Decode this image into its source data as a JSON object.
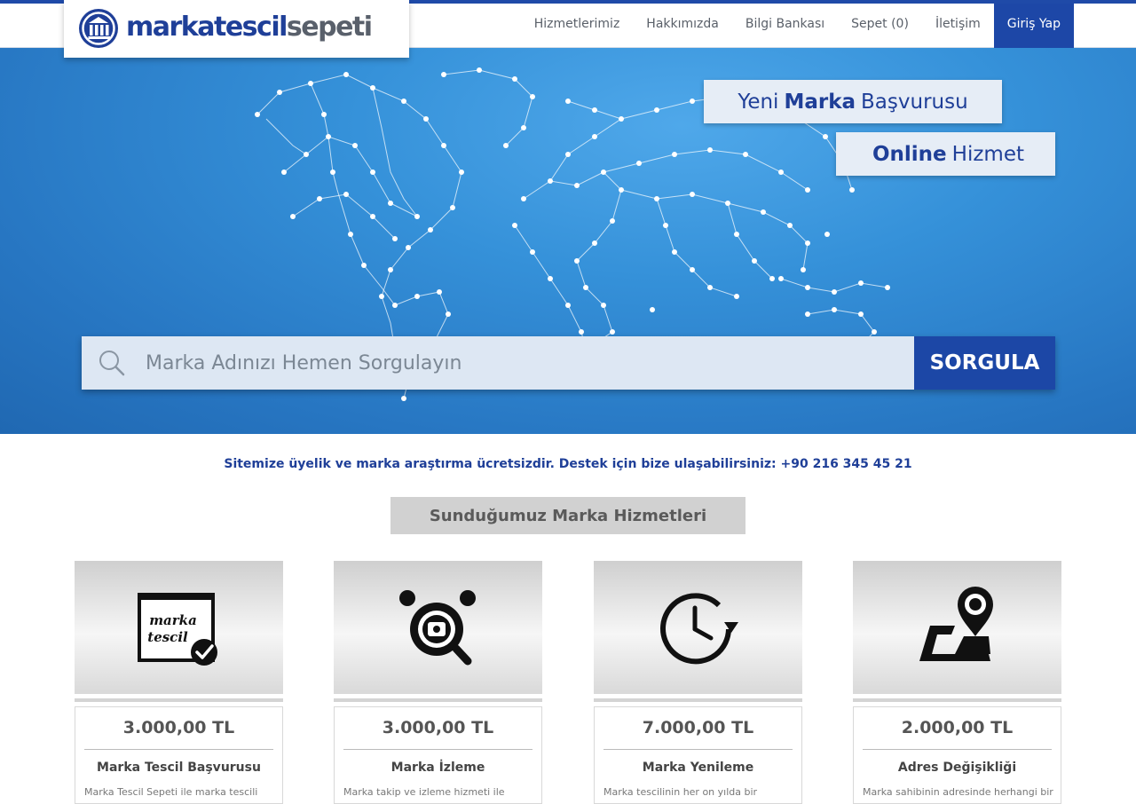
{
  "brand": {
    "part1": "markatescil",
    "part2": "sepeti"
  },
  "nav": [
    {
      "label": "Hizmetlerimiz"
    },
    {
      "label": "Hakkımızda"
    },
    {
      "label": "Bilgi Bankası"
    },
    {
      "label": "Sepet (0)"
    },
    {
      "label": "İletişim"
    },
    {
      "label": "Giriş Yap"
    }
  ],
  "hero": {
    "tag1": {
      "pre": "Yeni",
      "bold": "Marka",
      "post": "Başvurusu"
    },
    "tag2": {
      "bold": "Online",
      "post": "Hizmet"
    },
    "search": {
      "placeholder": "Marka Adınızı Hemen Sorgulayın",
      "button": "SORGULA"
    }
  },
  "info": "Sitemize üyelik ve marka araştırma ücretsizdir. Destek için bize ulaşabilirsiniz: +90 216 345 45 21",
  "section_title": "Sunduğumuz Marka Hizmetleri",
  "services": [
    {
      "price": "3.000,00 TL",
      "title": "Marka Tescil Başvurusu",
      "desc": "Marka Tescil Sepeti ile marka tescili",
      "icon": "certificate-icon",
      "icon_text1": "marka",
      "icon_text2": "tescil"
    },
    {
      "price": "3.000,00 TL",
      "title": "Marka İzleme",
      "desc": "Marka takip ve izleme hizmeti ile",
      "icon": "monitoring-icon"
    },
    {
      "price": "7.000,00 TL",
      "title": "Marka Yenileme",
      "desc": "Marka tescilinin her on yılda bir",
      "icon": "renewal-clock-icon"
    },
    {
      "price": "2.000,00 TL",
      "title": "Adres Değişikliği",
      "desc": "Marka sahibinin adresinde herhangi bir",
      "icon": "location-pin-icon"
    }
  ],
  "colors": {
    "brand_blue": "#1f3f98",
    "button_blue": "#1c47a6",
    "hero_blue": "#3591d9"
  }
}
